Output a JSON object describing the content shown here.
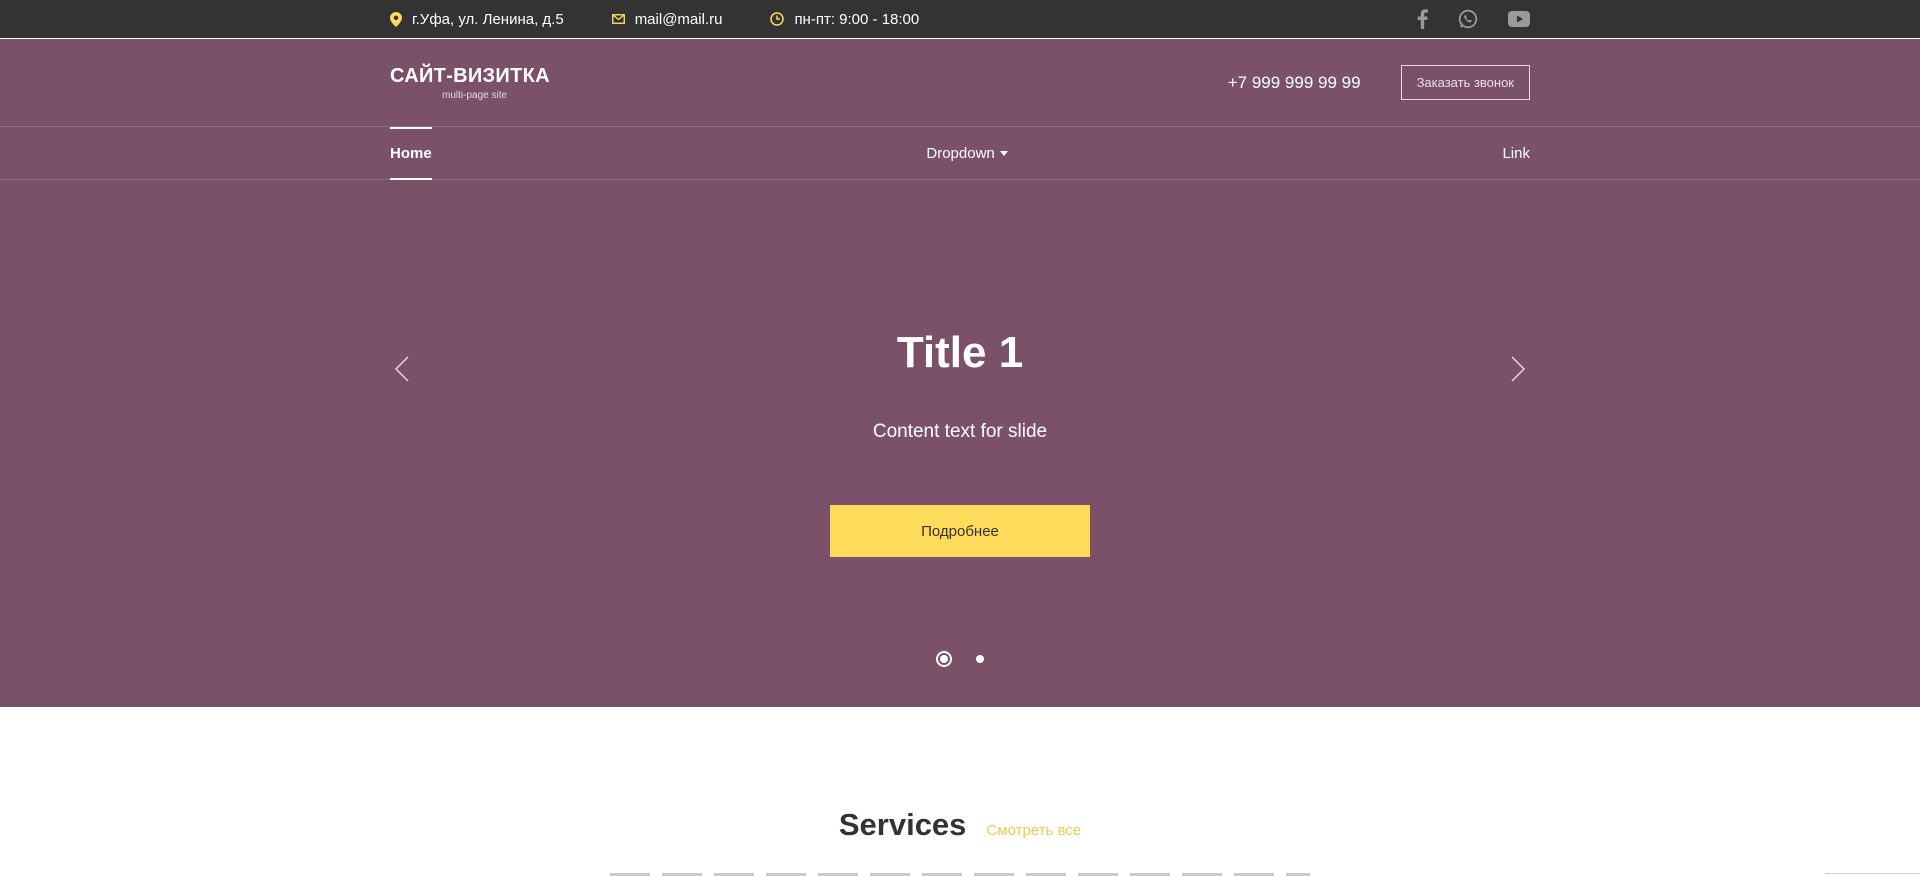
{
  "topbar": {
    "address": "г.Уфа, ул. Ленина, д.5",
    "email": "mail@mail.ru",
    "hours": "пн-пт: 9:00 - 18:00",
    "social": [
      "facebook-icon",
      "whatsapp-icon",
      "youtube-icon"
    ]
  },
  "header": {
    "logo_title": "САЙТ-ВИЗИТКА",
    "logo_subtitle": "multi-page site",
    "phone": "+7 999 999 99 99",
    "callback_label": "Заказать звонок"
  },
  "nav": {
    "items": [
      {
        "label": "Home",
        "active": true
      },
      {
        "label": "Dropdown",
        "dropdown": true
      },
      {
        "label": "Link"
      }
    ]
  },
  "hero": {
    "title": "Title 1",
    "text": "Content text for slide",
    "button_label": "Подробнее",
    "slide_count": 2,
    "active_slide": 1
  },
  "services": {
    "title": "Services",
    "link_label": "Смотреть все"
  },
  "colors": {
    "topbar_bg": "#333333",
    "brand_bg": "#7a5168",
    "accent_yellow": "#ffdb5c",
    "link_yellow": "#f2c94c"
  }
}
